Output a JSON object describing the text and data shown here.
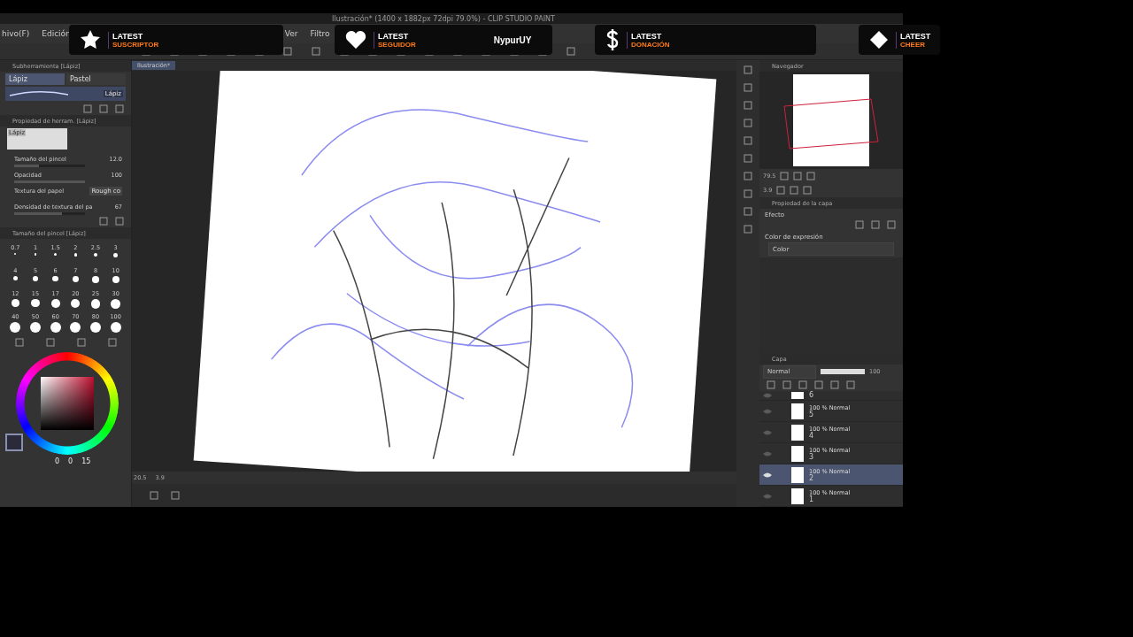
{
  "window": {
    "title": "Ilustración* (1400 x 1882px 72dpi 79.0%) - CLIP STUDIO PAINT"
  },
  "menu": [
    "hivo(F)",
    "Edición",
    "Ver",
    "Filtro"
  ],
  "alerts": [
    {
      "kind": "star",
      "label": "LATEST",
      "category": "SUSCRIPTOR"
    },
    {
      "kind": "heart",
      "label": "LATEST",
      "category": "SEGUIDOR",
      "name": "NypurUY"
    },
    {
      "kind": "dollar",
      "label": "LATEST",
      "category": "DONACIÓN"
    },
    {
      "kind": "diamond",
      "label": "LATEST",
      "category": "CHEER"
    }
  ],
  "subtool": {
    "title": "Subherramienta [Lápiz]",
    "tabs": [
      {
        "label": "Lápiz",
        "selected": true
      },
      {
        "label": "Pastel",
        "selected": false
      }
    ],
    "brush": "Lápiz"
  },
  "tool_property": {
    "title": "Propiedad de herram. [Lápiz]",
    "preview_label": "Lápiz",
    "rows": [
      {
        "label": "Tamaño del pincel",
        "value": "12.0",
        "level": 0.35
      },
      {
        "label": "Opacidad",
        "value": "100",
        "level": 1
      },
      {
        "label": "Textura del papel",
        "value": "Rough co"
      },
      {
        "label": "Densidad de textura del pa",
        "value": "67",
        "level": 0.67
      }
    ]
  },
  "brush_size": {
    "title": "Tamaño del pincel [Lápiz]",
    "sizes": [
      "0.7",
      "1",
      "1.5",
      "2",
      "2.5",
      "3",
      "4",
      "5",
      "6",
      "7",
      "8",
      "10",
      "12",
      "15",
      "17",
      "20",
      "25",
      "30",
      "40",
      "50",
      "60",
      "70",
      "80",
      "100"
    ]
  },
  "color": {
    "values": [
      "0",
      "0",
      "15"
    ]
  },
  "canvas": {
    "tab": "Ilustración*",
    "zoom": "20.5",
    "angle": "3.9"
  },
  "navigator": {
    "title": "Navegador",
    "zoom": "79.5",
    "angle": "3.9"
  },
  "layer_property": {
    "title": "Propiedad de la capa",
    "effect_label": "Efecto",
    "expression_label": "Color de expresión",
    "expression": "Color"
  },
  "layers": {
    "title": "Capa",
    "blend": "Normal",
    "opacity": "100",
    "items": [
      {
        "name": "6",
        "selected": false,
        "visible": false
      },
      {
        "mode": "100 % Normal",
        "name": "5",
        "selected": false,
        "visible": false
      },
      {
        "mode": "100 % Normal",
        "name": "4",
        "selected": false,
        "visible": false
      },
      {
        "mode": "100 % Normal",
        "name": "3",
        "selected": false,
        "visible": false
      },
      {
        "mode": "100 % Normal",
        "name": "2",
        "selected": true,
        "visible": true
      },
      {
        "mode": "100 % Normal",
        "name": "1",
        "selected": false,
        "visible": false
      }
    ]
  }
}
